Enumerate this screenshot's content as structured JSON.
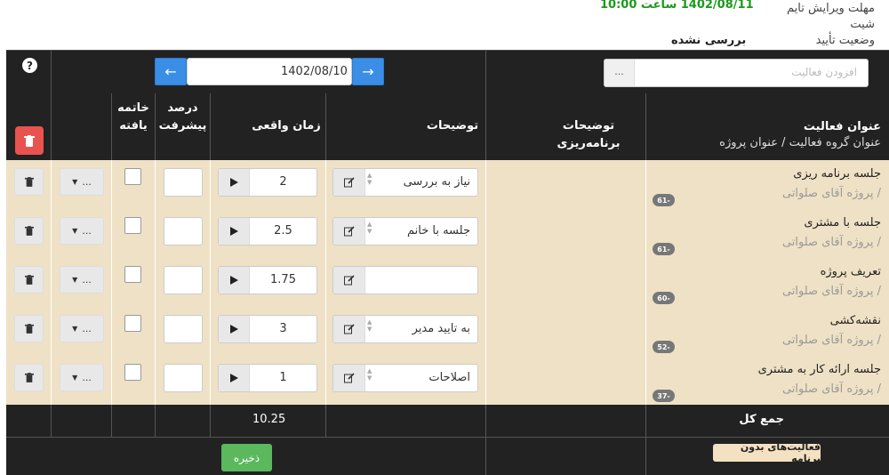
{
  "topinfo": {
    "edit_deadline_label": "مهلت ویرایش تایم شیت",
    "edit_deadline_value": "1402/08/11 ساعت 10:00",
    "status_label": "وضعیت تأیید",
    "status_value": "بررسی نشده"
  },
  "toolbar": {
    "help": "?",
    "date": "1402/08/10",
    "add_activity_placeholder": "افزودن فعالیت",
    "add_btn": "..."
  },
  "columns": {
    "activity_title": "عنوان فعالیت",
    "activity_sub": "عنوان گروه فعالیت  /  عنوان پروژه",
    "planning_desc": "توضیحات برنامه‌ریزی",
    "desc": "توضیحات",
    "actual_time": "زمان واقعی",
    "progress_l1": "درصد",
    "progress_l2": "پیشرفت",
    "finished_l1": "خاتمه",
    "finished_l2": "یافته"
  },
  "rows": [
    {
      "title": "جلسه برنامه ریزی",
      "project": "/ پروژه آقای صلواتی",
      "badge": "-61",
      "desc": "نیاز به بررسی",
      "time": "2"
    },
    {
      "title": "جلسه با مشتری",
      "project": "/ پروژه آقای صلواتی",
      "badge": "-61",
      "desc": "جلسه با خانم",
      "time": "2.5"
    },
    {
      "title": "تعریف پروژه",
      "project": "/ پروژه آقای صلواتی",
      "badge": "-60",
      "desc": "",
      "time": "1.75"
    },
    {
      "title": "نقشه‌کشی",
      "project": "/ پروژه آقای صلواتی",
      "badge": "-52",
      "desc": "به  تایید مدیر",
      "time": "3"
    },
    {
      "title": "جلسه ارائه کار به مشتری",
      "project": "/ پروژه آقای صلواتی",
      "badge": "-37",
      "desc": "اصلاحات",
      "time": "1"
    }
  ],
  "row_more_label": "...",
  "footer": {
    "total_label": "جمع کل",
    "total_value": "10.25",
    "unplanned_label": "فعالیت‌های بدون برنامه",
    "save_label": "ذخیره"
  },
  "colors": {
    "header_bg": "#222222",
    "row_bg": "#efe1c5",
    "primary": "#3a8ee6",
    "danger": "#e9534f",
    "success": "#5cb85c",
    "green_text": "#1a9a1a"
  }
}
